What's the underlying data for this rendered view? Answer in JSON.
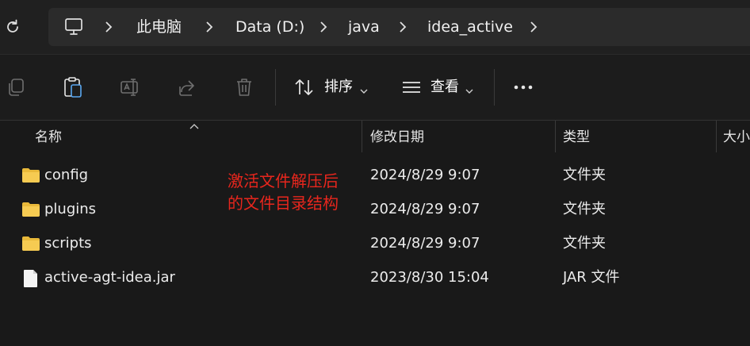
{
  "breadcrumb": {
    "items": [
      "此电脑",
      "Data (D:)",
      "java",
      "idea_active"
    ]
  },
  "toolbar": {
    "sort_label": "排序",
    "view_label": "查看"
  },
  "columns": {
    "name": "名称",
    "modified": "修改日期",
    "type": "类型",
    "size": "大小"
  },
  "files": [
    {
      "name": "config",
      "modified": "2024/8/29 9:07",
      "type": "文件夹",
      "icon": "folder-icon"
    },
    {
      "name": "plugins",
      "modified": "2024/8/29 9:07",
      "type": "文件夹",
      "icon": "folder-icon"
    },
    {
      "name": "scripts",
      "modified": "2024/8/29 9:07",
      "type": "文件夹",
      "icon": "folder-icon"
    },
    {
      "name": "active-agt-idea.jar",
      "modified": "2023/8/30 15:04",
      "type": "JAR 文件",
      "icon": "file-icon"
    }
  ],
  "annotation": {
    "line1": "激活文件解压后",
    "line2": "的文件目录结构",
    "color": "#e8261d"
  },
  "colors": {
    "background": "#191919",
    "folder": "#f4c542"
  }
}
